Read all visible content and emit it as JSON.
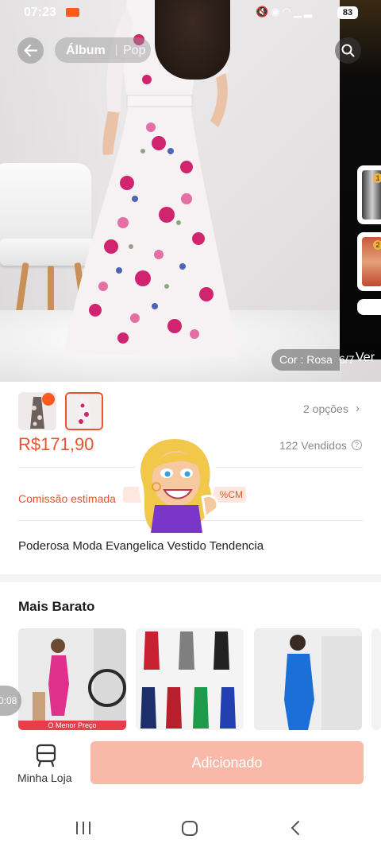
{
  "status_bar": {
    "time": "07:23",
    "battery": "83"
  },
  "top_bar": {
    "tabs": [
      "Álbum",
      "Pop"
    ],
    "active_tab": "Álbum"
  },
  "gallery": {
    "color_label": "Cor : Rosa",
    "page_counter": "6/7",
    "side_label": "Ver",
    "side_thumbnail_numbers": [
      "1",
      "2"
    ]
  },
  "product": {
    "options_link": "2 opções",
    "price": "R$171,90",
    "sold": "122 Vendidos",
    "commission_label": "Comissão estimada",
    "commission_value": "%CM",
    "title": "Poderosa Moda Evangelica Vestido Tendencia"
  },
  "cheaper_section": {
    "title": "Mais Barato",
    "cards": [
      {
        "tag": "O Menor Preço"
      },
      {
        "tag": ""
      },
      {
        "tag": ""
      }
    ]
  },
  "video_timer": "0:08",
  "bottom_bar": {
    "store_label": "Minha Loja",
    "action_label": "Adicionado"
  },
  "colors": {
    "accent": "#e8522e",
    "button_disabled": "#f9b9a8"
  }
}
